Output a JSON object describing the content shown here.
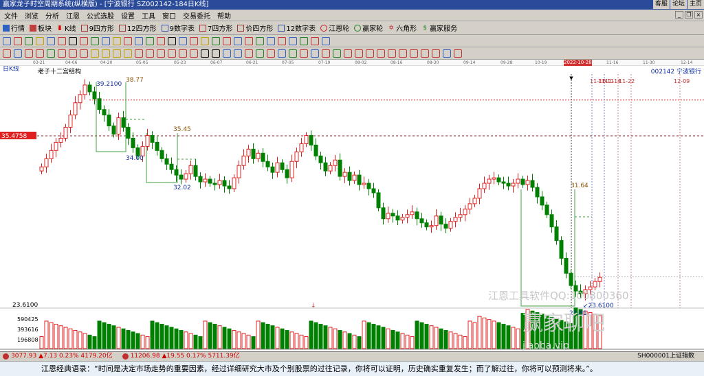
{
  "window": {
    "title": "赢家龙子时空周期系统(纵横版) - [宁波银行  SZ002142-184日K线]",
    "right_links": [
      "客服",
      "论坛",
      "主页"
    ]
  },
  "menu": [
    "文件",
    "浏览",
    "分析",
    "江恩",
    "公式选股",
    "设置",
    "工具",
    "窗口",
    "交易委托",
    "帮助"
  ],
  "toolbar1": [
    {
      "label": "行情",
      "icon": "grid-icon"
    },
    {
      "label": "板块",
      "icon": "blocks-icon"
    },
    {
      "label": "K线",
      "icon": "candle-icon"
    },
    {
      "label": "9四方形",
      "icon": "square9-icon"
    },
    {
      "label": "12四方形",
      "icon": "square12-icon"
    },
    {
      "label": "9数字表",
      "icon": "table9-icon"
    },
    {
      "label": "7四方形",
      "icon": "square7-icon"
    },
    {
      "label": "价四方形",
      "icon": "pricesquare-icon"
    },
    {
      "label": "12数字表",
      "icon": "table12-icon"
    },
    {
      "label": "江恩轮",
      "icon": "wheel-icon"
    },
    {
      "label": "赢家轮",
      "icon": "wheel2-icon"
    },
    {
      "label": "六角形",
      "icon": "hexagon-icon"
    },
    {
      "label": "赢家服务",
      "icon": "service-icon"
    }
  ],
  "date_ticks": [
    "03-21",
    "04-06",
    "04-20",
    "05-05",
    "05-23",
    "06-07",
    "06-21",
    "07-05",
    "07-19",
    "08-02",
    "08-16",
    "08-30",
    "09-14",
    "09-28",
    "10-19",
    "2022-10-28",
    "11-16",
    "11-30",
    "12-14"
  ],
  "chart": {
    "period_label": "日K线",
    "structure_label": "老子十二宫结构",
    "stock_code": "002142",
    "stock_name": "宁波银行",
    "crosshair_price": "35.4758",
    "cursor_date": "2022-10-28",
    "future_dates": [
      "11-10",
      "11-11",
      "11-14",
      "11-22",
      "12-09"
    ],
    "price_labels": {
      "p3921": "39.2100",
      "p3877": "38.77",
      "p3545": "35.45",
      "p3400": "34.00",
      "p3202": "32.02",
      "p3164": "31.64",
      "p2361": "23.6100",
      "p2361b": "23.6100",
      "p2381": "23.81"
    },
    "volume_labels": [
      "590425",
      "393616",
      "196808"
    ],
    "watermark1": "江恩工具软件QQ:100800360",
    "watermark2": "赢家聊吧",
    "watermark3": "jiaoba.vip"
  },
  "chart_data": {
    "type": "candlestick",
    "title": "宁波银行 002142 日K线",
    "ylim": [
      23.0,
      40.0
    ],
    "y_labels_left": [
      35.4758,
      23.61
    ],
    "key_levels": [
      39.21,
      38.77,
      35.45,
      34.0,
      32.02,
      31.64,
      23.81,
      23.61
    ],
    "closes": [
      33.2,
      33.8,
      34.4,
      35.0,
      35.3,
      36.1,
      37.0,
      37.9,
      38.5,
      39.2,
      38.7,
      38.2,
      37.4,
      37.0,
      36.2,
      35.6,
      36.8,
      36.1,
      35.3,
      34.6,
      34.0,
      34.7,
      35.5,
      35.0,
      34.4,
      33.8,
      33.4,
      33.0,
      32.6,
      32.3,
      32.7,
      33.3,
      32.5,
      32.1,
      32.3,
      32.0,
      31.9,
      32.2,
      31.8,
      31.6,
      32.4,
      33.3,
      34.0,
      34.5,
      33.8,
      34.2,
      33.6,
      33.2,
      32.8,
      33.5,
      33.0,
      32.4,
      33.6,
      34.3,
      34.9,
      35.5,
      34.8,
      34.0,
      33.5,
      32.9,
      33.3,
      33.7,
      32.5,
      32.8,
      32.2,
      32.6,
      31.9,
      32.0,
      31.6,
      31.3,
      30.2,
      29.4,
      29.8,
      29.6,
      29.3,
      29.5,
      29.7,
      29.9,
      29.4,
      29.1,
      28.8,
      28.9,
      29.6,
      29.0,
      28.7,
      29.2,
      29.5,
      29.7,
      30.1,
      30.5,
      30.9,
      31.6,
      32.0,
      32.3,
      32.4,
      32.1,
      32.0,
      31.8,
      32.0,
      32.3,
      31.9,
      32.2,
      31.7,
      31.0,
      30.4,
      29.7,
      28.8,
      27.8,
      26.5,
      25.4,
      24.5,
      24.1,
      23.9,
      24.2,
      24.4,
      24.8,
      25.1
    ],
    "volume_axis": [
      196808,
      393616,
      590425
    ]
  },
  "status": {
    "idx1": {
      "value": "3077.93",
      "change": "▲7.13",
      "pct": "0.23%",
      "amount": "4179.20亿"
    },
    "idx2": {
      "value": "11206.98",
      "change": "▲19.55",
      "pct": "0.17%",
      "amount": "5711.39亿"
    },
    "right_text": "SH000001上证指数"
  },
  "quote": "江恩经典语录：“时间是决定市场走势的重要因素，经过详细研究大市及个别股票的过往记录，你将可以证明，历史确实重复发生；而了解过往，你将可以预测将来。”。"
}
